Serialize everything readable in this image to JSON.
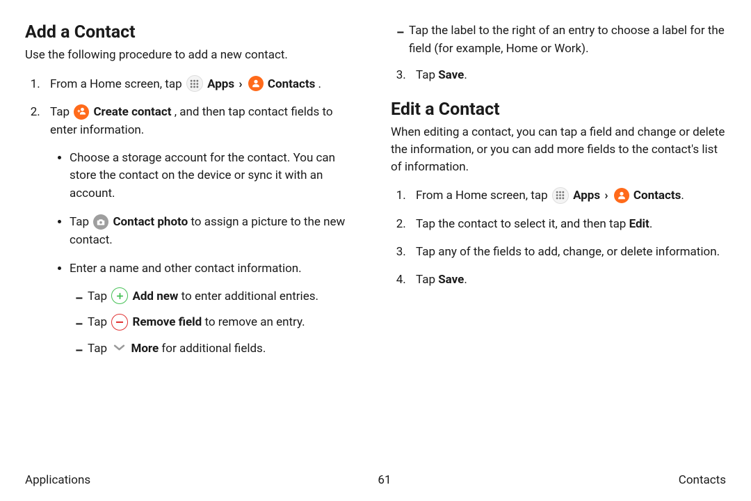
{
  "add": {
    "heading": "Add a Contact",
    "intro": "Use the following procedure to add a new contact.",
    "step1_a": "From a Home screen, tap ",
    "apps_label": "Apps",
    "caret": "›",
    "contacts_label": "Contacts",
    "period": " .",
    "step2_a": "Tap ",
    "create_contact_label": "Create contact",
    "step2_b": " , and then tap contact fields to enter information.",
    "bullet1": "Choose a storage account for the contact. You can store the contact on the device or sync it with an account.",
    "bullet2_a": "Tap ",
    "contact_photo_label": "Contact photo",
    "bullet2_b": "  to assign a picture to the new contact.",
    "bullet3": "Enter a name and other contact information.",
    "dash1_a": "Tap ",
    "add_new_label": "Add new",
    "dash1_b": "  to enter additional entries.",
    "dash2_a": "Tap ",
    "remove_field_label": "Remove field",
    "dash2_b": "  to remove an entry.",
    "dash3_a": "Tap ",
    "more_label": "More",
    "dash3_b": "  for additional fields.",
    "dash4": "Tap the label to the right of an entry to choose a label for the field (for example, Home or Work).",
    "step3_a": "Tap ",
    "save_label": "Save",
    "step3_b": "."
  },
  "edit": {
    "heading": "Edit a Contact",
    "intro": "When editing a contact, you can tap a field and change or delete the information, or you can add more fields to the contact's list of information.",
    "step1_a": "From a Home screen, tap ",
    "apps_label": "Apps",
    "caret": "›",
    "contacts_label": "Contacts",
    "period": ".",
    "step2_a": "Tap the contact to select it, and then tap ",
    "edit_label": "Edit",
    "step2_b": ".",
    "step3": "Tap any of the fields to add, change, or delete information.",
    "step4_a": "Tap ",
    "save_label": "Save",
    "step4_b": "."
  },
  "footer": {
    "left": "Applications",
    "center": "61",
    "right": "Contacts"
  }
}
